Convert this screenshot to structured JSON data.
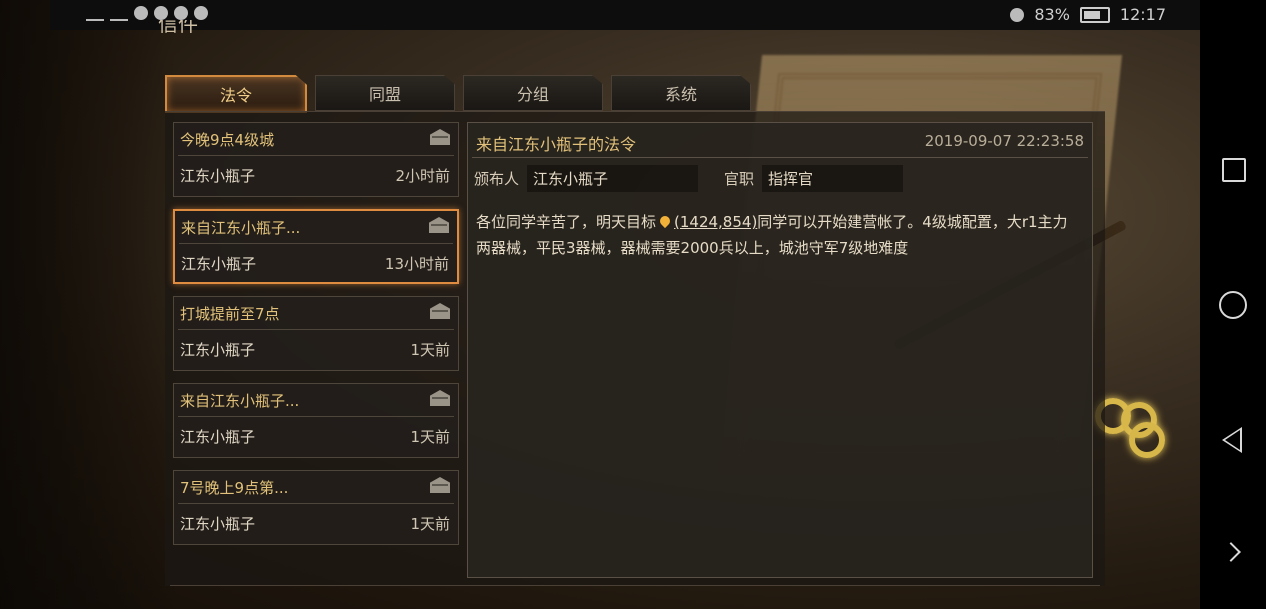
{
  "status_bar": {
    "battery": "83%",
    "time": "12:17"
  },
  "window": {
    "title": "信件"
  },
  "tabs": [
    {
      "label": "法令",
      "active": true
    },
    {
      "label": "同盟",
      "active": false
    },
    {
      "label": "分组",
      "active": false
    },
    {
      "label": "系统",
      "active": false
    }
  ],
  "mail_list": [
    {
      "subject": "今晚9点4级城",
      "sender": "江东小瓶子",
      "time": "2小时前",
      "selected": false
    },
    {
      "subject": "来自江东小瓶子...",
      "sender": "江东小瓶子",
      "time": "13小时前",
      "selected": true
    },
    {
      "subject": "打城提前至7点",
      "sender": "江东小瓶子",
      "time": "1天前",
      "selected": false
    },
    {
      "subject": "来自江东小瓶子...",
      "sender": "江东小瓶子",
      "time": "1天前",
      "selected": false
    },
    {
      "subject": "7号晚上9点第...",
      "sender": "江东小瓶子",
      "time": "1天前",
      "selected": false
    }
  ],
  "detail": {
    "title": "来自江东小瓶子的法令",
    "date": "2019-09-07 22:23:58",
    "publisher_label": "颁布人",
    "publisher": "江东小瓶子",
    "rank_label": "官职",
    "rank": "指挥官",
    "body_before": "各位同学辛苦了，明天目标",
    "coords": "(1424,854)",
    "body_after": "同学可以开始建营帐了。4级城配置，大r1主力两器械，平民3器械，器械需要2000兵以上，城池守军7级地难度"
  },
  "colors": {
    "accent": "#e08c40",
    "subject": "#e2c27a",
    "pin": "#f2b23a"
  }
}
